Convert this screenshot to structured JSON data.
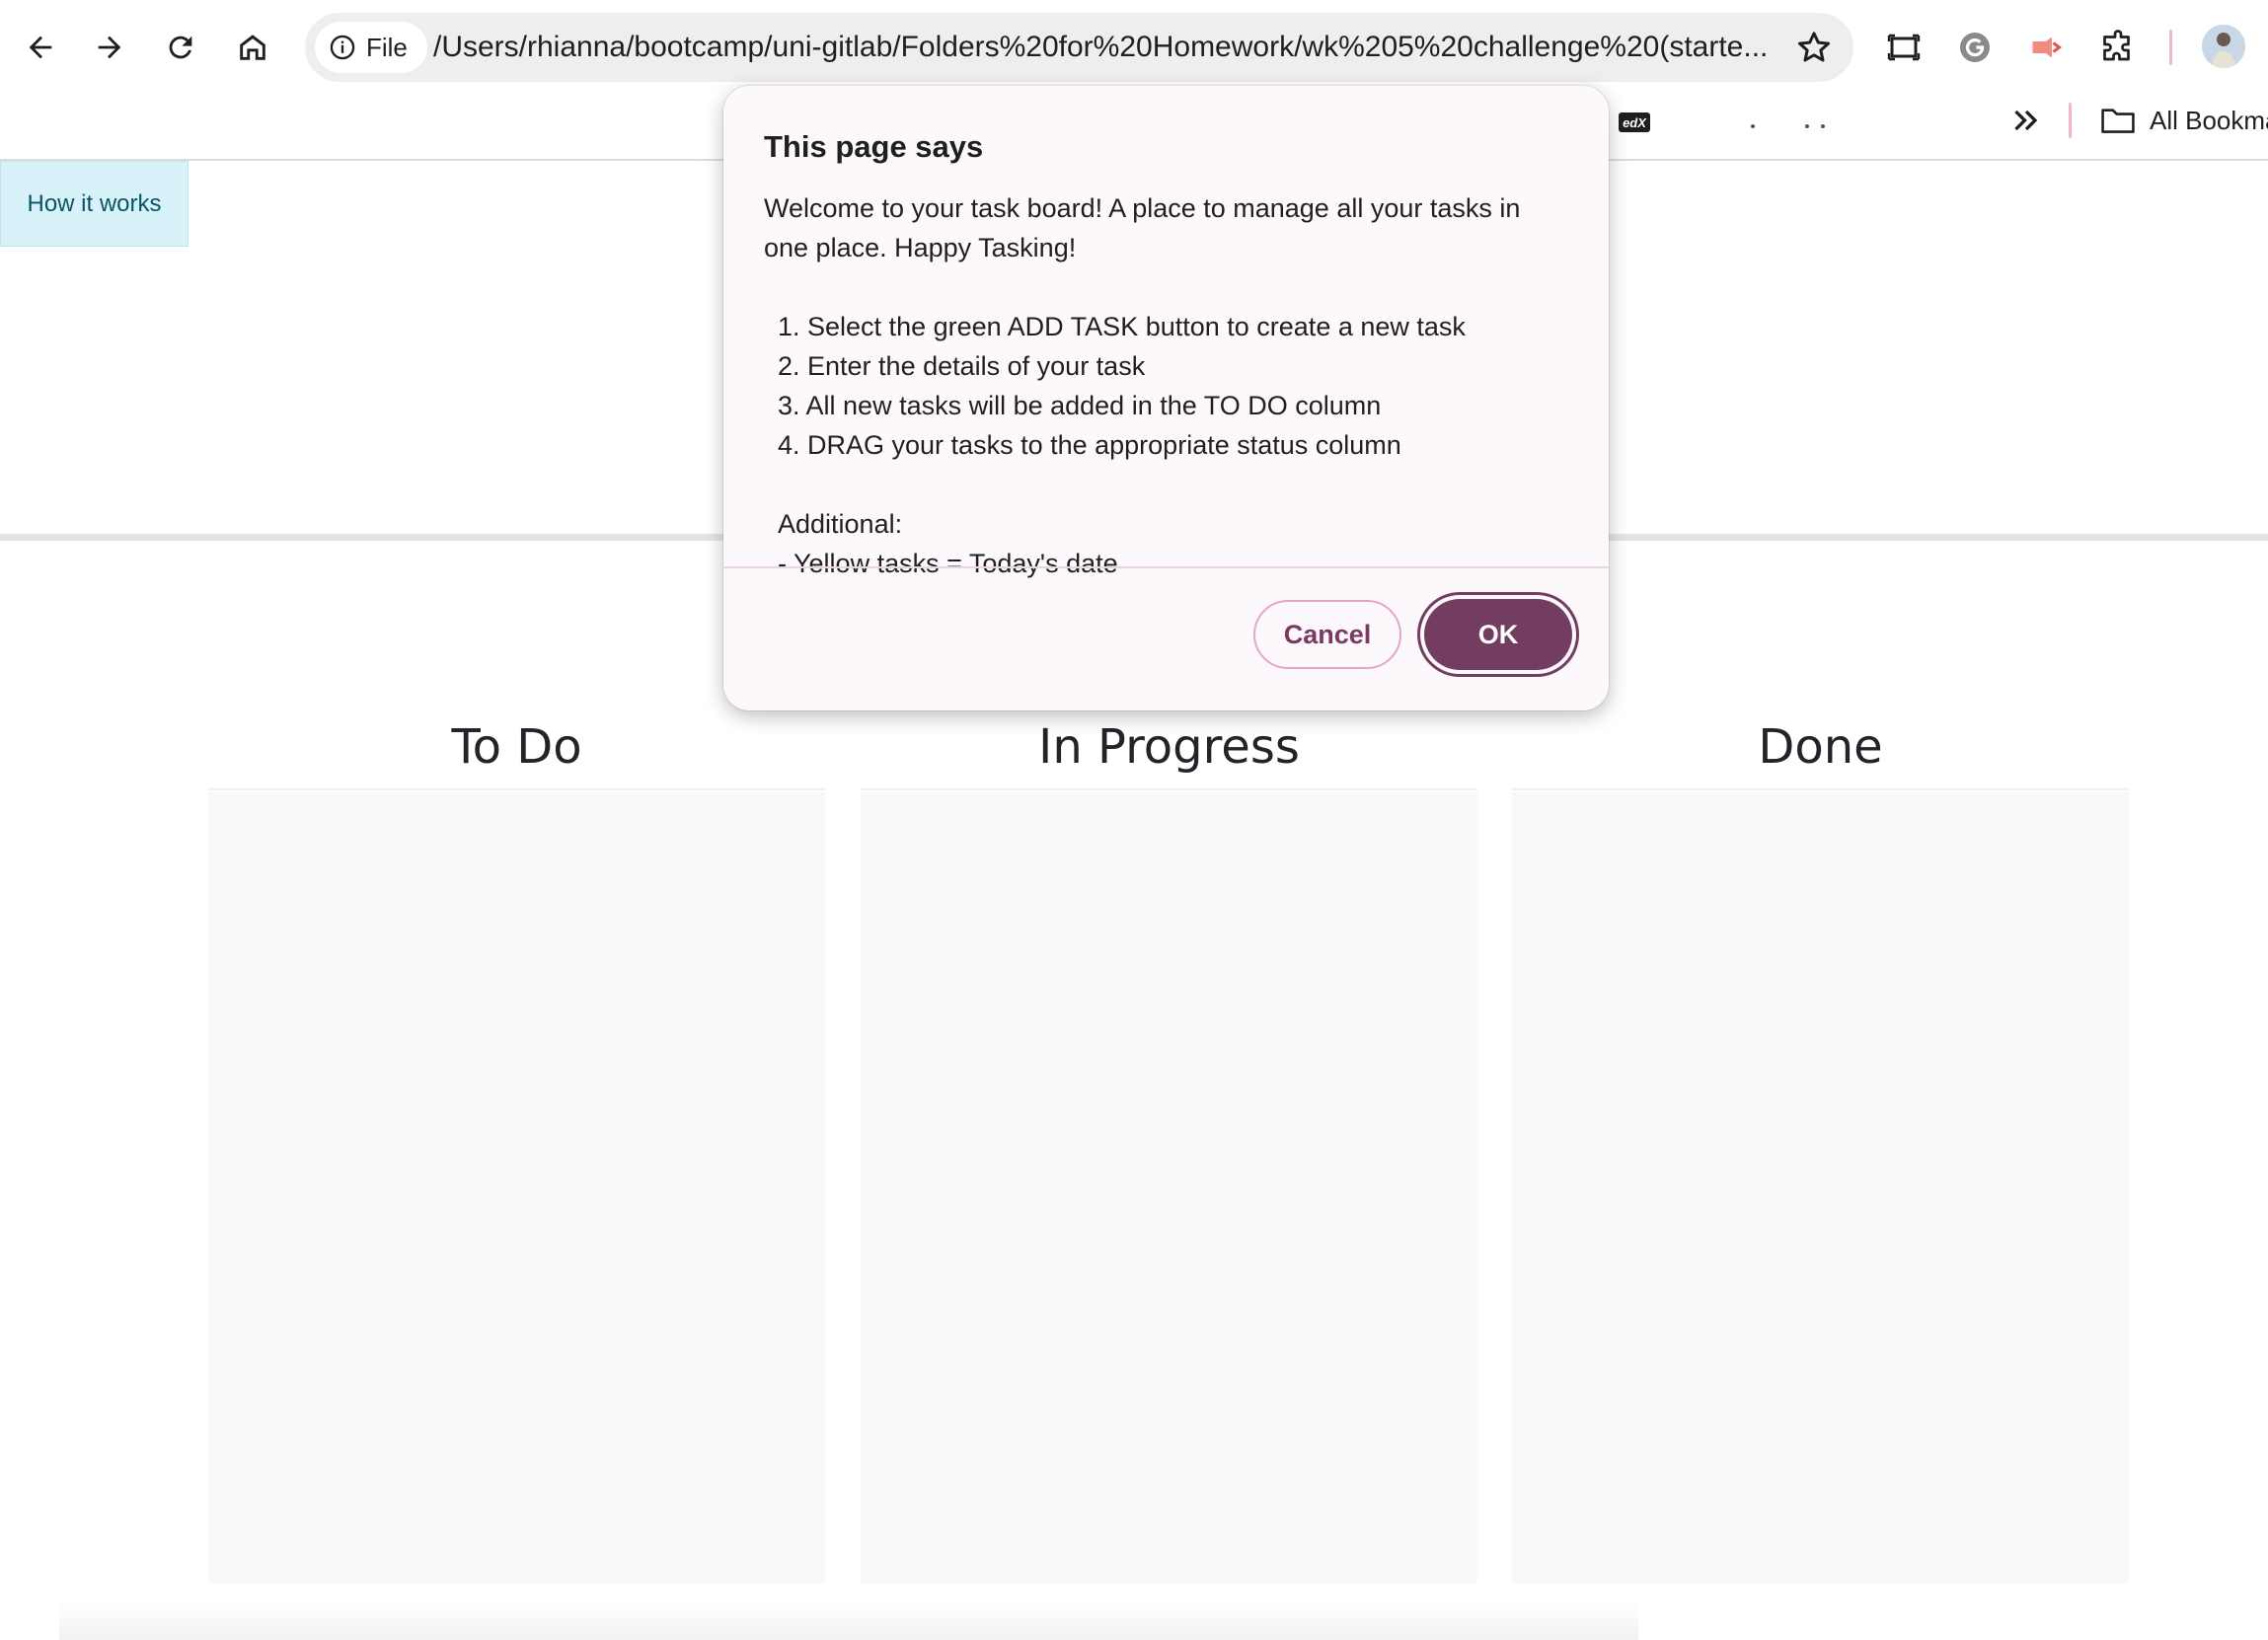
{
  "browser": {
    "file_chip_label": "File",
    "url": "/Users/rhianna/bootcamp/uni-gitlab/Folders%20for%20Homework/wk%205%20challenge%20(starte...",
    "bookmarks": {
      "all_bookmarks_label": "All Bookmarks",
      "edx_label": "edX"
    },
    "icons": {
      "back": "arrow-left",
      "forward": "arrow-right",
      "reload": "reload",
      "home": "home",
      "info": "info-circle",
      "star": "star-outline",
      "screen": "screen-capture",
      "grammarly": "grammarly",
      "extension_red": "red-extension",
      "puzzle": "puzzle-piece",
      "more_bookmarks": "double-chevron-right",
      "folder": "folder"
    }
  },
  "page": {
    "how_it_works_label": "How it works",
    "columns": [
      {
        "title": "To Do"
      },
      {
        "title": "In Progress"
      },
      {
        "title": "Done"
      }
    ]
  },
  "dialog": {
    "title": "This page says",
    "lines": [
      "Welcome to your task board! A place to manage all your tasks in",
      "one place. Happy Tasking!",
      "",
      "1. Select the green ADD TASK button to create a new task",
      "2. Enter the details of your task",
      "3. All new tasks will be added in the TO DO column",
      "4. DRAG your tasks to the appropriate status column",
      "",
      "Additional:",
      "- Yellow tasks = Today's date"
    ],
    "cancel_label": "Cancel",
    "ok_label": "OK"
  },
  "colors": {
    "how_it_works_bg": "#d7f2f9",
    "dialog_accent": "#733d62",
    "board_body_bg": "#f8f9fa"
  }
}
